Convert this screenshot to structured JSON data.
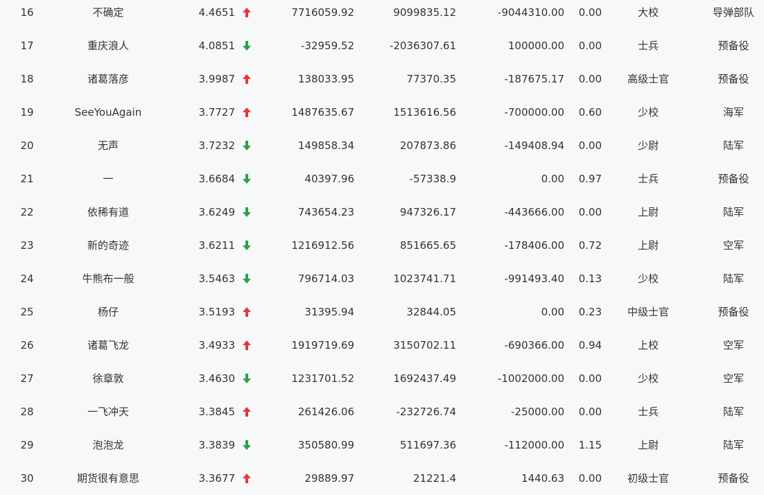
{
  "colors": {
    "up": "#e53935",
    "down": "#2ea043",
    "row_bg": "#f7f8fa",
    "text": "#333333"
  },
  "rows": [
    {
      "rank": "16",
      "name": "不确定",
      "score": "4.4651",
      "trend": "up",
      "v1": "7716059.92",
      "v2": "9099835.12",
      "v3": "-9044310.00",
      "ratio": "0.00",
      "rank_title": "大校",
      "branch": "导弹部队"
    },
    {
      "rank": "17",
      "name": "重庆浪人",
      "score": "4.0851",
      "trend": "down",
      "v1": "-32959.52",
      "v2": "-2036307.61",
      "v3": "100000.00",
      "ratio": "0.00",
      "rank_title": "士兵",
      "branch": "预备役"
    },
    {
      "rank": "18",
      "name": "诸葛落彦",
      "score": "3.9987",
      "trend": "up",
      "v1": "138033.95",
      "v2": "77370.35",
      "v3": "-187675.17",
      "ratio": "0.00",
      "rank_title": "高级士官",
      "branch": "预备役"
    },
    {
      "rank": "19",
      "name": "SeeYouAgain",
      "score": "3.7727",
      "trend": "up",
      "v1": "1487635.67",
      "v2": "1513616.56",
      "v3": "-700000.00",
      "ratio": "0.60",
      "rank_title": "少校",
      "branch": "海军"
    },
    {
      "rank": "20",
      "name": "无声",
      "score": "3.7232",
      "trend": "down",
      "v1": "149858.34",
      "v2": "207873.86",
      "v3": "-149408.94",
      "ratio": "0.00",
      "rank_title": "少尉",
      "branch": "陆军"
    },
    {
      "rank": "21",
      "name": "一",
      "score": "3.6684",
      "trend": "down",
      "v1": "40397.96",
      "v2": "-57338.9",
      "v3": "0.00",
      "ratio": "0.97",
      "rank_title": "士兵",
      "branch": "预备役"
    },
    {
      "rank": "22",
      "name": "依稀有道",
      "score": "3.6249",
      "trend": "down",
      "v1": "743654.23",
      "v2": "947326.17",
      "v3": "-443666.00",
      "ratio": "0.00",
      "rank_title": "上尉",
      "branch": "陆军"
    },
    {
      "rank": "23",
      "name": "新的奇迹",
      "score": "3.6211",
      "trend": "down",
      "v1": "1216912.56",
      "v2": "851665.65",
      "v3": "-178406.00",
      "ratio": "0.72",
      "rank_title": "上尉",
      "branch": "空军"
    },
    {
      "rank": "24",
      "name": "牛熊布一般",
      "score": "3.5463",
      "trend": "down",
      "v1": "796714.03",
      "v2": "1023741.71",
      "v3": "-991493.40",
      "ratio": "0.13",
      "rank_title": "少校",
      "branch": "陆军"
    },
    {
      "rank": "25",
      "name": "杨仔",
      "score": "3.5193",
      "trend": "up",
      "v1": "31395.94",
      "v2": "32844.05",
      "v3": "0.00",
      "ratio": "0.23",
      "rank_title": "中级士官",
      "branch": "预备役"
    },
    {
      "rank": "26",
      "name": "诸葛飞龙",
      "score": "3.4933",
      "trend": "up",
      "v1": "1919719.69",
      "v2": "3150702.11",
      "v3": "-690366.00",
      "ratio": "0.94",
      "rank_title": "上校",
      "branch": "空军"
    },
    {
      "rank": "27",
      "name": "徐章敦",
      "score": "3.4630",
      "trend": "down",
      "v1": "1231701.52",
      "v2": "1692437.49",
      "v3": "-1002000.00",
      "ratio": "0.00",
      "rank_title": "少校",
      "branch": "空军"
    },
    {
      "rank": "28",
      "name": "一飞冲天",
      "score": "3.3845",
      "trend": "up",
      "v1": "261426.06",
      "v2": "-232726.74",
      "v3": "-25000.00",
      "ratio": "0.00",
      "rank_title": "士兵",
      "branch": "陆军"
    },
    {
      "rank": "29",
      "name": "泡泡龙",
      "score": "3.3839",
      "trend": "down",
      "v1": "350580.99",
      "v2": "511697.36",
      "v3": "-112000.00",
      "ratio": "1.15",
      "rank_title": "上尉",
      "branch": "陆军"
    },
    {
      "rank": "30",
      "name": "期货很有意思",
      "score": "3.3677",
      "trend": "up",
      "v1": "29889.97",
      "v2": "21221.4",
      "v3": "1440.63",
      "ratio": "0.00",
      "rank_title": "初级士官",
      "branch": "预备役"
    }
  ]
}
